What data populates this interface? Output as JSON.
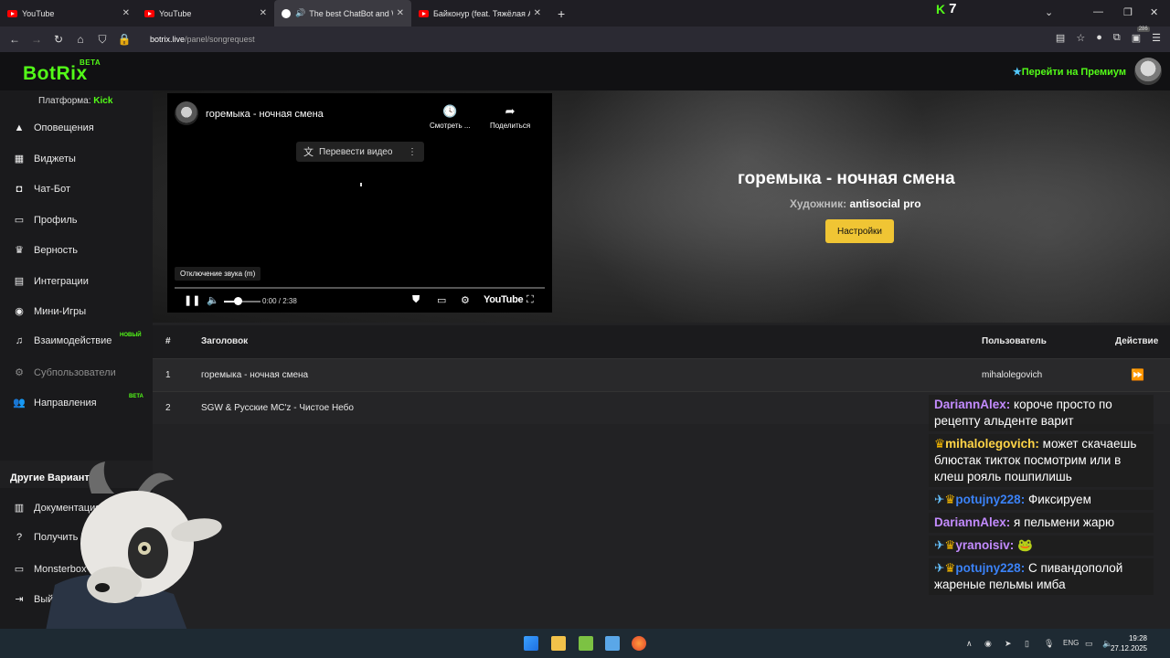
{
  "browser": {
    "tabs": [
      {
        "label": "YouTube"
      },
      {
        "label": "YouTube"
      },
      {
        "label": "The best ChatBot and Widg"
      },
      {
        "label": "Байконур (feat. Тяжёлая Атлет"
      }
    ],
    "kick_count": "7",
    "url_host": "botrix.live",
    "url_path": "/panel/songrequest",
    "extension_badge": "286"
  },
  "header": {
    "logo": "BotRix",
    "logo_badge": "BETA",
    "premium_label": "Перейти на Премиум"
  },
  "sidebar": {
    "platform_label": "Платформа:",
    "platform_value": "Kick",
    "items": [
      {
        "label": "Оповещения",
        "icon": "warning-icon"
      },
      {
        "label": "Виджеты",
        "icon": "grid-icon"
      },
      {
        "label": "Чат-Бот",
        "icon": "robot-icon"
      },
      {
        "label": "Профиль",
        "icon": "id-card-icon"
      },
      {
        "label": "Верность",
        "icon": "trophy-icon"
      },
      {
        "label": "Интеграции",
        "icon": "server-icon"
      },
      {
        "label": "Мини-Игры",
        "icon": "gamepad-icon"
      },
      {
        "label": "Взаимодействие",
        "icon": "music-icon",
        "badge": "НОВЫЙ"
      },
      {
        "label": "Субпользователи",
        "icon": "gear-icon"
      },
      {
        "label": "Направления",
        "icon": "users-icon",
        "badge": "BETA"
      }
    ],
    "section_title": "Другие Варианты",
    "other_items": [
      {
        "label": "Документация",
        "icon": "book-icon"
      },
      {
        "label": "Получить Поддержку",
        "icon": "question-icon"
      },
      {
        "label": "Monsterbox",
        "icon": "laptop-icon"
      },
      {
        "label": "Выйти",
        "icon": "logout-icon"
      }
    ]
  },
  "player": {
    "video_title": "горемыка - ночная смена",
    "watch_label": "Смотреть ...",
    "share_label": "Поделиться",
    "translate_label": "Перевести видео",
    "tooltip": "Отключение звука (m)",
    "time": "0:00 / 2:38",
    "brand": "YouTube",
    "song_title": "горемыка - ночная смена",
    "artist_label": "Художник:",
    "artist_value": "antisocial pro",
    "settings_button": "Настройки"
  },
  "queue": {
    "headers": {
      "num": "#",
      "title": "Заголовок",
      "user": "Пользователь",
      "action": "Действие"
    },
    "rows": [
      {
        "num": "1",
        "title": "горемыка - ночная смена",
        "user": "mihalolegovich"
      },
      {
        "num": "2",
        "title": "SGW & Русские MC'z - Чистое Небо",
        "user": ""
      }
    ]
  },
  "chat": [
    {
      "nick": "DariannAlex",
      "badges": "",
      "text": "короче просто по рецепту альденте варит"
    },
    {
      "nick": "mihalolegovich",
      "badges": "crown",
      "text": "может скачаешь блюстак тикток посмотрим или в клеш рояль пошпилишь"
    },
    {
      "nick": "potujny228",
      "badges": "pin-crown",
      "text": "Фиксируем"
    },
    {
      "nick": "DariannAlex",
      "badges": "",
      "text": "я пельмени жарю"
    },
    {
      "nick": "yranoisiv",
      "badges": "pin-crown",
      "text": "🐸"
    },
    {
      "nick": "potujny228",
      "badges": "pin-crown",
      "text": "С пивандополой жареные пельмы имба"
    }
  ],
  "taskbar": {
    "lang": "ENG",
    "time": "19:28",
    "date": "27.12.2025"
  }
}
